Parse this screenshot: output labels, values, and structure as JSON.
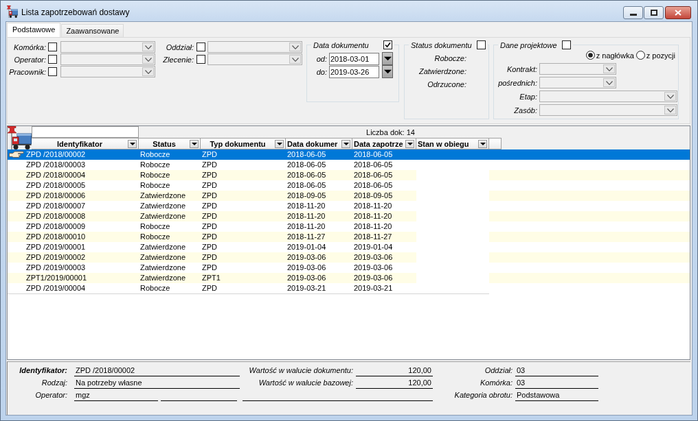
{
  "window": {
    "title": "Lista zapotrzebowań dostawy"
  },
  "tabs": [
    {
      "label": "Podstawowe",
      "selected": true
    },
    {
      "label": "Zaawansowane",
      "selected": false
    }
  ],
  "filters": {
    "left": [
      {
        "label": "Komórka:",
        "checked": false
      },
      {
        "label": "Operator:",
        "checked": false
      },
      {
        "label": "Pracownik:",
        "checked": false
      }
    ],
    "middle": [
      {
        "label": "Oddział:",
        "checked": false
      },
      {
        "label": "Zlecenie:",
        "checked": false
      }
    ],
    "date": {
      "title": "Data dokumentu",
      "checked": true,
      "fields": [
        {
          "label": "od:",
          "value": "2018-03-01"
        },
        {
          "label": "do:",
          "value": "2019-03-26"
        }
      ]
    },
    "status": {
      "title": "Status dokumentu",
      "checked": false,
      "items": [
        "Robocze:",
        "Zatwierdzone:",
        "Odrzucone:"
      ]
    },
    "project": {
      "title": "Dane projektowe",
      "checked": false,
      "radios": [
        {
          "label": "z nagłówka",
          "selected": true
        },
        {
          "label": "z pozycji",
          "selected": false
        }
      ],
      "fields": [
        {
          "label": "Kontrakt:",
          "kind": "short"
        },
        {
          "label": "pośrednich:",
          "kind": "short"
        },
        {
          "label": "Etap:",
          "kind": "long"
        },
        {
          "label": "Zasób:",
          "kind": "long"
        }
      ]
    }
  },
  "grid": {
    "count": "Liczba dok: 14",
    "columns": [
      "Identyfikator",
      "Status",
      "Typ dokumentu",
      "Data dokumer",
      "Data zapotrze",
      "Stan w obiegu"
    ],
    "rows": [
      {
        "cells": [
          "ZPD /2018/00002",
          "Robocze",
          "ZPD",
          "2018-06-05",
          "2018-06-05"
        ],
        "selected": true
      },
      {
        "cells": [
          "ZPD /2018/00003",
          "Robocze",
          "ZPD",
          "2018-06-05",
          "2018-06-05"
        ],
        "selected": false
      },
      {
        "cells": [
          "ZPD /2018/00004",
          "Robocze",
          "ZPD",
          "2018-06-05",
          "2018-06-05"
        ],
        "selected": false
      },
      {
        "cells": [
          "ZPD /2018/00005",
          "Robocze",
          "ZPD",
          "2018-06-05",
          "2018-06-05"
        ],
        "selected": false
      },
      {
        "cells": [
          "ZPD /2018/00006",
          "Zatwierdzone",
          "ZPD",
          "2018-09-05",
          "2018-09-05"
        ],
        "selected": false
      },
      {
        "cells": [
          "ZPD /2018/00007",
          "Zatwierdzone",
          "ZPD",
          "2018-11-20",
          "2018-11-20"
        ],
        "selected": false
      },
      {
        "cells": [
          "ZPD /2018/00008",
          "Zatwierdzone",
          "ZPD",
          "2018-11-20",
          "2018-11-20"
        ],
        "selected": false
      },
      {
        "cells": [
          "ZPD /2018/00009",
          "Robocze",
          "ZPD",
          "2018-11-20",
          "2018-11-20"
        ],
        "selected": false
      },
      {
        "cells": [
          "ZPD /2018/00010",
          "Robocze",
          "ZPD",
          "2018-11-27",
          "2018-11-27"
        ],
        "selected": false
      },
      {
        "cells": [
          "ZPD /2019/00001",
          "Zatwierdzone",
          "ZPD",
          "2019-01-04",
          "2019-01-04"
        ],
        "selected": false
      },
      {
        "cells": [
          "ZPD /2019/00002",
          "Zatwierdzone",
          "ZPD",
          "2019-03-06",
          "2019-03-06"
        ],
        "selected": false
      },
      {
        "cells": [
          "ZPD /2019/00003",
          "Zatwierdzone",
          "ZPD",
          "2019-03-06",
          "2019-03-06"
        ],
        "selected": false
      },
      {
        "cells": [
          "ZPT1/2019/00001",
          "Zatwierdzone",
          "ZPT1",
          "2019-03-06",
          "2019-03-06"
        ],
        "selected": false
      },
      {
        "cells": [
          "ZPD /2019/00004",
          "Robocze",
          "ZPD",
          "2019-03-21",
          "2019-03-21"
        ],
        "selected": false
      }
    ]
  },
  "details": {
    "rows": [
      {
        "left": {
          "kind": "key",
          "label": "Identyfikator:",
          "value": "ZPD /2018/00002"
        },
        "middle": {
          "kind": "amount",
          "label": "Wartość w walucie dokumentu:",
          "value": "120,00"
        },
        "right": {
          "label": "Oddział:",
          "value": "03"
        }
      },
      {
        "left": {
          "kind": "plain",
          "label": "Rodzaj:",
          "value": "Na potrzeby własne"
        },
        "middle": {
          "kind": "amount",
          "label": "Wartość w walucie bazowej:",
          "value": "120,00"
        },
        "right": {
          "label": "Komórka:",
          "value": "03"
        }
      },
      {
        "left": {
          "kind": "split",
          "label": "Operator:",
          "value": "mgz"
        },
        "middle": {
          "kind": "blank"
        },
        "right": {
          "label": "Kategoria obrotu:",
          "value": "Podstawowa"
        }
      }
    ]
  }
}
